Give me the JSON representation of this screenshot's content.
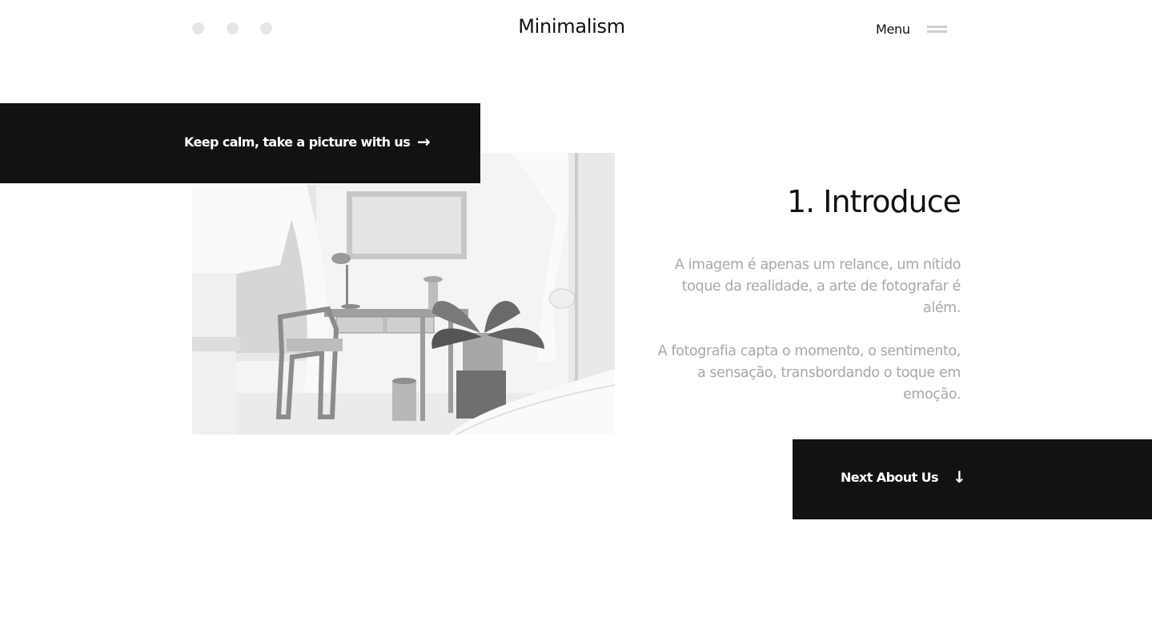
{
  "header": {
    "brand": "Minimalism",
    "menu_label": "Menu",
    "window_dots": [
      "dot",
      "dot",
      "dot"
    ]
  },
  "hero": {
    "cta_label": "Keep calm, take a picture with us",
    "cta_icon": "arrow-right-icon",
    "image_alt": "Black and white interior with a wooden desk, chair, lamp, framed picture and plant"
  },
  "intro": {
    "title": "1. Introduce",
    "paragraph_1": "A imagem é apenas um relance, um nítido toque da realidade, a arte de fotografar é além.",
    "paragraph_2": "A fotografia capta o momento, o sentimento, a sensação, transbordando o toque em emoção."
  },
  "next": {
    "label": "Next About Us",
    "icon": "arrow-down-icon"
  },
  "colors": {
    "background": "#ffffff",
    "dark_block": "#121212",
    "text_dark": "#111111",
    "text_muted": "#a8a8a8",
    "dot": "#e6e6e6",
    "hamburger": "#cfcfcf"
  }
}
